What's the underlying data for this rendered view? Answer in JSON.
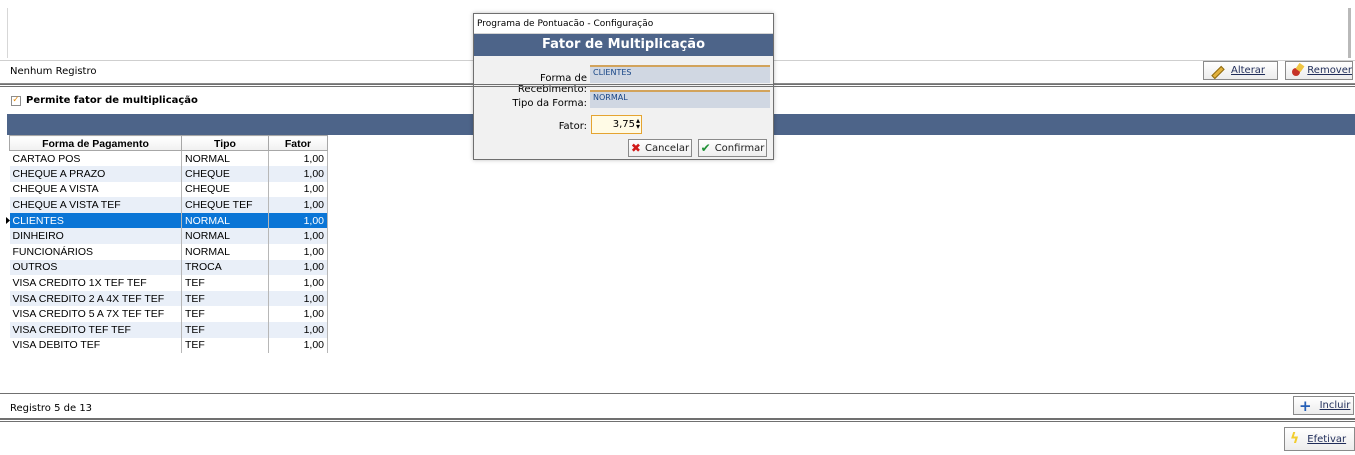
{
  "top_status": {
    "text": "Nenhum Registro"
  },
  "toolbar": {
    "alterar_label": "Alterar",
    "remover_label": "Remover",
    "incluir_label": "Incluir",
    "efetivar_label": "Efetivar"
  },
  "checkbox": {
    "label": "Permite fator de multiplicação",
    "checked": true
  },
  "grid": {
    "columns": [
      "Forma de Pagamento",
      "Tipo",
      "Fator"
    ],
    "rows": [
      [
        "CARTAO POS",
        "NORMAL",
        "1,00"
      ],
      [
        "CHEQUE A PRAZO",
        "CHEQUE",
        "1,00"
      ],
      [
        "CHEQUE A VISTA",
        "CHEQUE",
        "1,00"
      ],
      [
        "CHEQUE A VISTA TEF",
        "CHEQUE TEF",
        "1,00"
      ],
      [
        "CLIENTES",
        "NORMAL",
        "1,00"
      ],
      [
        "DINHEIRO",
        "NORMAL",
        "1,00"
      ],
      [
        "FUNCIONÁRIOS",
        "NORMAL",
        "1,00"
      ],
      [
        "OUTROS",
        "TROCA",
        "1,00"
      ],
      [
        "VISA CREDITO 1X TEF TEF",
        "TEF",
        "1,00"
      ],
      [
        "VISA CREDITO 2 A 4X TEF TEF",
        "TEF",
        "1,00"
      ],
      [
        "VISA CREDITO 5 A 7X TEF TEF",
        "TEF",
        "1,00"
      ],
      [
        "VISA CREDITO TEF TEF",
        "TEF",
        "1,00"
      ],
      [
        "VISA DEBITO TEF",
        "TEF",
        "1,00"
      ]
    ],
    "selected_index": 4
  },
  "footer": {
    "text": "Registro 5 de 13"
  },
  "dialog": {
    "title": "Programa de Pontuacão - Configuração",
    "header": "Fator de Multiplicação",
    "forma_label": "Forma de Recebimento:",
    "forma_value": "CLIENTES",
    "tipo_label": "Tipo da Forma:",
    "tipo_value": "NORMAL",
    "fator_label": "Fator:",
    "fator_value": "3,75",
    "cancel_label": "Cancelar",
    "confirm_label": "Confirmar"
  },
  "colors": {
    "header_band": "#4d6489",
    "selection": "#0a75d6",
    "alternate_row": "#e9eff8",
    "input_highlight": "#e5a431"
  }
}
